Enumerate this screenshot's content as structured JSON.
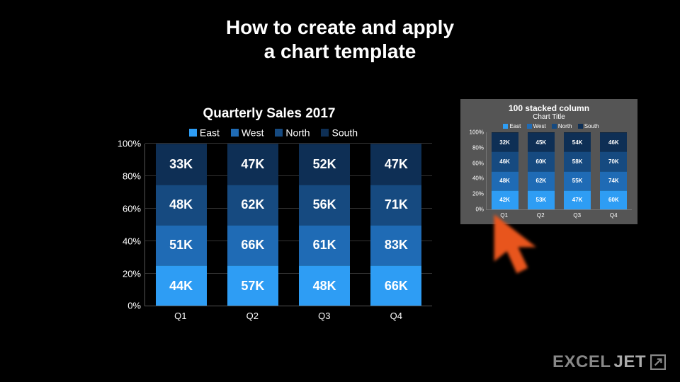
{
  "heading_line1": "How to create and apply",
  "heading_line2": "a chart template",
  "brand_part1": "EXCEL",
  "brand_part2": "JET",
  "colors": {
    "east": "#2E9DF4",
    "west": "#1F6BB5",
    "north": "#164A80",
    "south": "#0E2F55"
  },
  "chart_data": {
    "type": "bar",
    "stacked": "100%",
    "title": "Quarterly Sales 2017",
    "categories": [
      "Q1",
      "Q2",
      "Q3",
      "Q4"
    ],
    "series": [
      {
        "name": "East",
        "values": [
          44,
          57,
          48,
          66
        ],
        "labels": [
          "44K",
          "57K",
          "48K",
          "66K"
        ]
      },
      {
        "name": "West",
        "values": [
          51,
          66,
          61,
          83
        ],
        "labels": [
          "51K",
          "66K",
          "61K",
          "83K"
        ]
      },
      {
        "name": "North",
        "values": [
          48,
          62,
          56,
          71
        ],
        "labels": [
          "48K",
          "62K",
          "56K",
          "71K"
        ]
      },
      {
        "name": "South",
        "values": [
          33,
          47,
          52,
          47
        ],
        "labels": [
          "33K",
          "47K",
          "52K",
          "47K"
        ]
      }
    ],
    "ylabel": "",
    "xlabel": "",
    "yticks": [
      "0%",
      "20%",
      "40%",
      "60%",
      "80%",
      "100%"
    ]
  },
  "thumb_chart": {
    "type": "bar",
    "stacked": "100%",
    "name": "100 stacked column",
    "title": "Chart Title",
    "categories": [
      "Q1",
      "Q2",
      "Q3",
      "Q4"
    ],
    "series": [
      {
        "name": "East",
        "labels": [
          "42K",
          "53K",
          "47K",
          "60K"
        ]
      },
      {
        "name": "West",
        "labels": [
          "48K",
          "62K",
          "55K",
          "74K"
        ]
      },
      {
        "name": "North",
        "labels": [
          "46K",
          "60K",
          "58K",
          "70K"
        ]
      },
      {
        "name": "South",
        "labels": [
          "32K",
          "45K",
          "54K",
          "46K"
        ]
      }
    ],
    "yticks": [
      "0%",
      "20%",
      "40%",
      "60%",
      "80%",
      "100%"
    ]
  }
}
